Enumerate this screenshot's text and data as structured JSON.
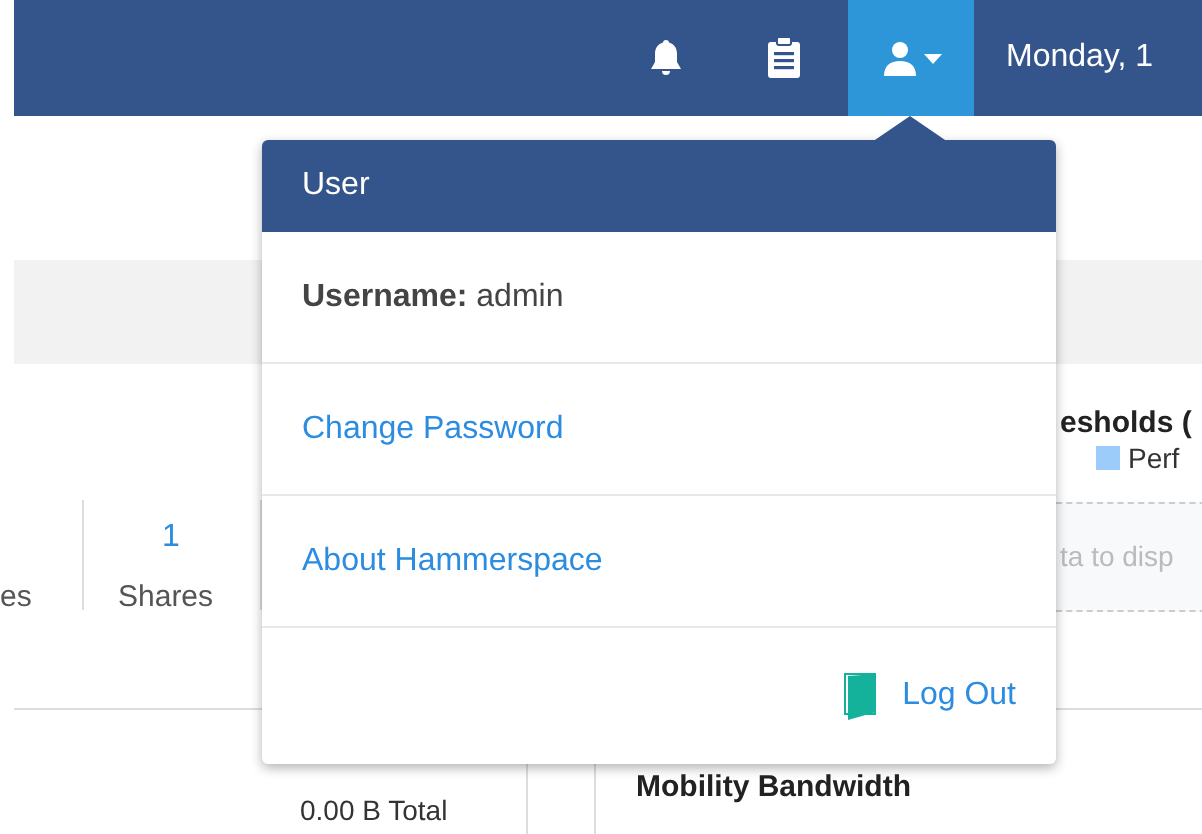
{
  "top_bar": {
    "user_button": {
      "selected": true
    },
    "date": "Monday, 1"
  },
  "background": {
    "stat_fragment": "es",
    "shares": {
      "value": "1",
      "label": "Shares"
    },
    "thresholds_title": "esholds (",
    "legend": {
      "label": "Perf",
      "color": "#9ccdfa"
    },
    "empty_message": "ta to disp",
    "bandwidth_title": "Mobility Bandwidth",
    "total": "0.00 B Total"
  },
  "user_menu": {
    "title": "User",
    "username_label": "Username:",
    "username": "admin",
    "links": [
      "Change Password",
      "About Hammerspace"
    ],
    "logout": "Log Out"
  }
}
